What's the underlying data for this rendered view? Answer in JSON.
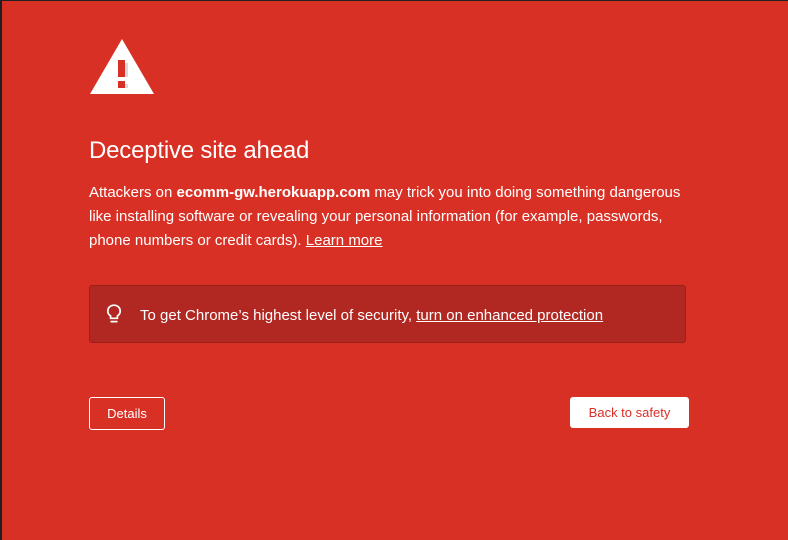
{
  "colors": {
    "background": "#d93025",
    "info_box": "#b12822",
    "text": "#ffffff",
    "primary_button_text": "#d93025"
  },
  "icons": {
    "warning": "warning-triangle-icon",
    "tip": "lightbulb-icon"
  },
  "headline": "Deceptive site ahead",
  "body": {
    "prefix": "Attackers on ",
    "site": "ecomm-gw.herokuapp.com",
    "suffix": " may trick you into doing something dangerous like installing software or revealing your personal information (for example, passwords, phone numbers or credit cards). ",
    "learn_more": "Learn more"
  },
  "enhanced_protection": {
    "prefix": "To get Chrome’s highest level of security, ",
    "link": "turn on enhanced protection"
  },
  "buttons": {
    "details": "Details",
    "back_to_safety": "Back to safety"
  }
}
